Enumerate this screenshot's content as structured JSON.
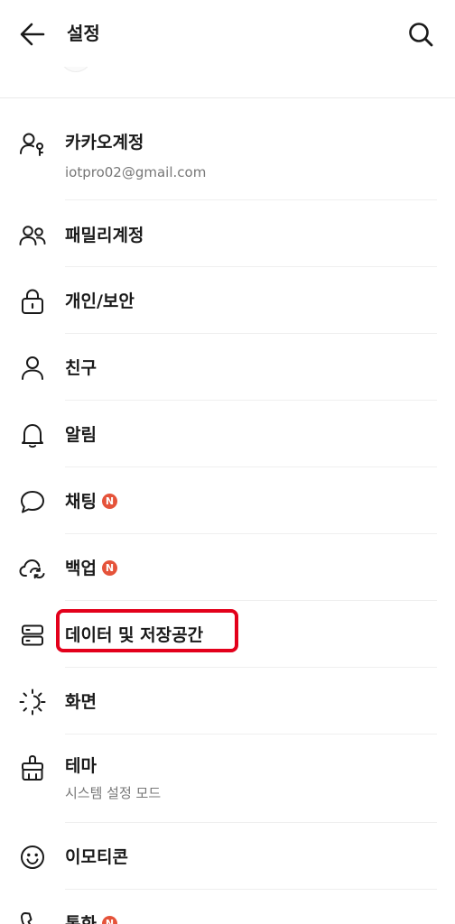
{
  "header": {
    "title": "설정",
    "back_icon": "arrow-left-icon",
    "search_icon": "search-icon"
  },
  "menu": [
    {
      "id": "kakao-account",
      "label": "카카오계정",
      "sub": "iotpro02@gmail.com",
      "icon": "person-key-icon",
      "badge": ""
    },
    {
      "id": "family-account",
      "label": "패밀리계정",
      "sub": "",
      "icon": "people-icon",
      "badge": ""
    },
    {
      "id": "privacy-security",
      "label": "개인/보안",
      "sub": "",
      "icon": "lock-icon",
      "badge": ""
    },
    {
      "id": "friends",
      "label": "친구",
      "sub": "",
      "icon": "person-icon",
      "badge": ""
    },
    {
      "id": "notifications",
      "label": "알림",
      "sub": "",
      "icon": "bell-icon",
      "badge": ""
    },
    {
      "id": "chatting",
      "label": "채팅",
      "sub": "",
      "icon": "chat-bubble-icon",
      "badge": "N"
    },
    {
      "id": "backup",
      "label": "백업",
      "sub": "",
      "icon": "cloud-sync-icon",
      "badge": "N"
    },
    {
      "id": "data-storage",
      "label": "데이터 및 저장공간",
      "sub": "",
      "icon": "storage-icon",
      "badge": ""
    },
    {
      "id": "display",
      "label": "화면",
      "sub": "",
      "icon": "brightness-icon",
      "badge": ""
    },
    {
      "id": "theme",
      "label": "테마",
      "sub": "시스템 설정 모드",
      "icon": "paint-brush-icon",
      "badge": ""
    },
    {
      "id": "emoticon",
      "label": "이모티콘",
      "sub": "",
      "icon": "smiley-icon",
      "badge": ""
    },
    {
      "id": "call",
      "label": "통화",
      "sub": "",
      "icon": "phone-icon",
      "badge": "N"
    }
  ],
  "colors": {
    "highlight": "#e3001b",
    "badge": "#e5533a",
    "subtext": "#777777"
  }
}
